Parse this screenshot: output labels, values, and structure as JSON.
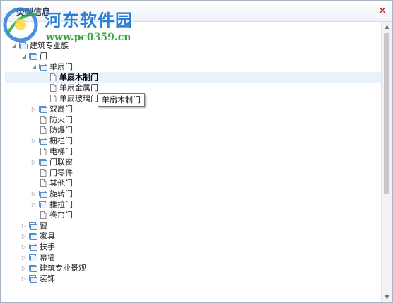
{
  "window": {
    "title": "类型信息",
    "close_icon": "close-icon",
    "close_glyph": "✕"
  },
  "watermark": {
    "title": "河东软件园",
    "url": "www.pc0359.cn"
  },
  "tree": {
    "expanded_glyph": "◢",
    "collapsed_glyph": "▷",
    "items": [
      {
        "label": "建筑专业族",
        "depth": 0,
        "toggle": "expanded",
        "icon": "folder-icon"
      },
      {
        "label": "门",
        "depth": 1,
        "toggle": "expanded",
        "icon": "folder-icon"
      },
      {
        "label": "单扇门",
        "depth": 2,
        "toggle": "expanded",
        "icon": "folder-icon"
      },
      {
        "label": "单扇木制门",
        "depth": 3,
        "toggle": "none",
        "icon": "document-icon",
        "selected": true
      },
      {
        "label": "单扇金属门",
        "depth": 3,
        "toggle": "none",
        "icon": "document-icon"
      },
      {
        "label": "单扇玻璃门",
        "depth": 3,
        "toggle": "none",
        "icon": "document-icon"
      },
      {
        "label": "双扇门",
        "depth": 2,
        "toggle": "collapsed",
        "icon": "folder-icon"
      },
      {
        "label": "防火门",
        "depth": 2,
        "toggle": "none",
        "icon": "document-icon"
      },
      {
        "label": "防爆门",
        "depth": 2,
        "toggle": "none",
        "icon": "document-icon"
      },
      {
        "label": "栅栏门",
        "depth": 2,
        "toggle": "collapsed",
        "icon": "folder-icon"
      },
      {
        "label": "电梯门",
        "depth": 2,
        "toggle": "none",
        "icon": "document-icon"
      },
      {
        "label": "门联窗",
        "depth": 2,
        "toggle": "collapsed",
        "icon": "folder-icon"
      },
      {
        "label": "门零件",
        "depth": 2,
        "toggle": "none",
        "icon": "document-icon"
      },
      {
        "label": "其他门",
        "depth": 2,
        "toggle": "none",
        "icon": "document-icon"
      },
      {
        "label": "旋转门",
        "depth": 2,
        "toggle": "collapsed",
        "icon": "folder-icon"
      },
      {
        "label": "推拉门",
        "depth": 2,
        "toggle": "collapsed",
        "icon": "folder-icon"
      },
      {
        "label": "卷帘门",
        "depth": 2,
        "toggle": "none",
        "icon": "document-icon"
      },
      {
        "label": "窗",
        "depth": 1,
        "toggle": "collapsed",
        "icon": "folder-icon"
      },
      {
        "label": "家具",
        "depth": 1,
        "toggle": "collapsed",
        "icon": "folder-icon"
      },
      {
        "label": "扶手",
        "depth": 1,
        "toggle": "collapsed",
        "icon": "folder-icon"
      },
      {
        "label": "幕墙",
        "depth": 1,
        "toggle": "collapsed",
        "icon": "folder-icon"
      },
      {
        "label": "建筑专业景观",
        "depth": 1,
        "toggle": "collapsed",
        "icon": "folder-icon"
      },
      {
        "label": "装饰",
        "depth": 1,
        "toggle": "collapsed",
        "icon": "folder-icon"
      }
    ]
  },
  "tooltip": {
    "text": "单扇木制门"
  },
  "scrollbar": {
    "up_glyph": "▲",
    "down_glyph": "▼"
  },
  "colors": {
    "selection": "#e9f1fb",
    "folder": "#5b8fc9",
    "document": "#8c8c8c",
    "watermark_title": "#2a7fd4",
    "watermark_url": "#2fa73c",
    "close": "#b0242a"
  }
}
